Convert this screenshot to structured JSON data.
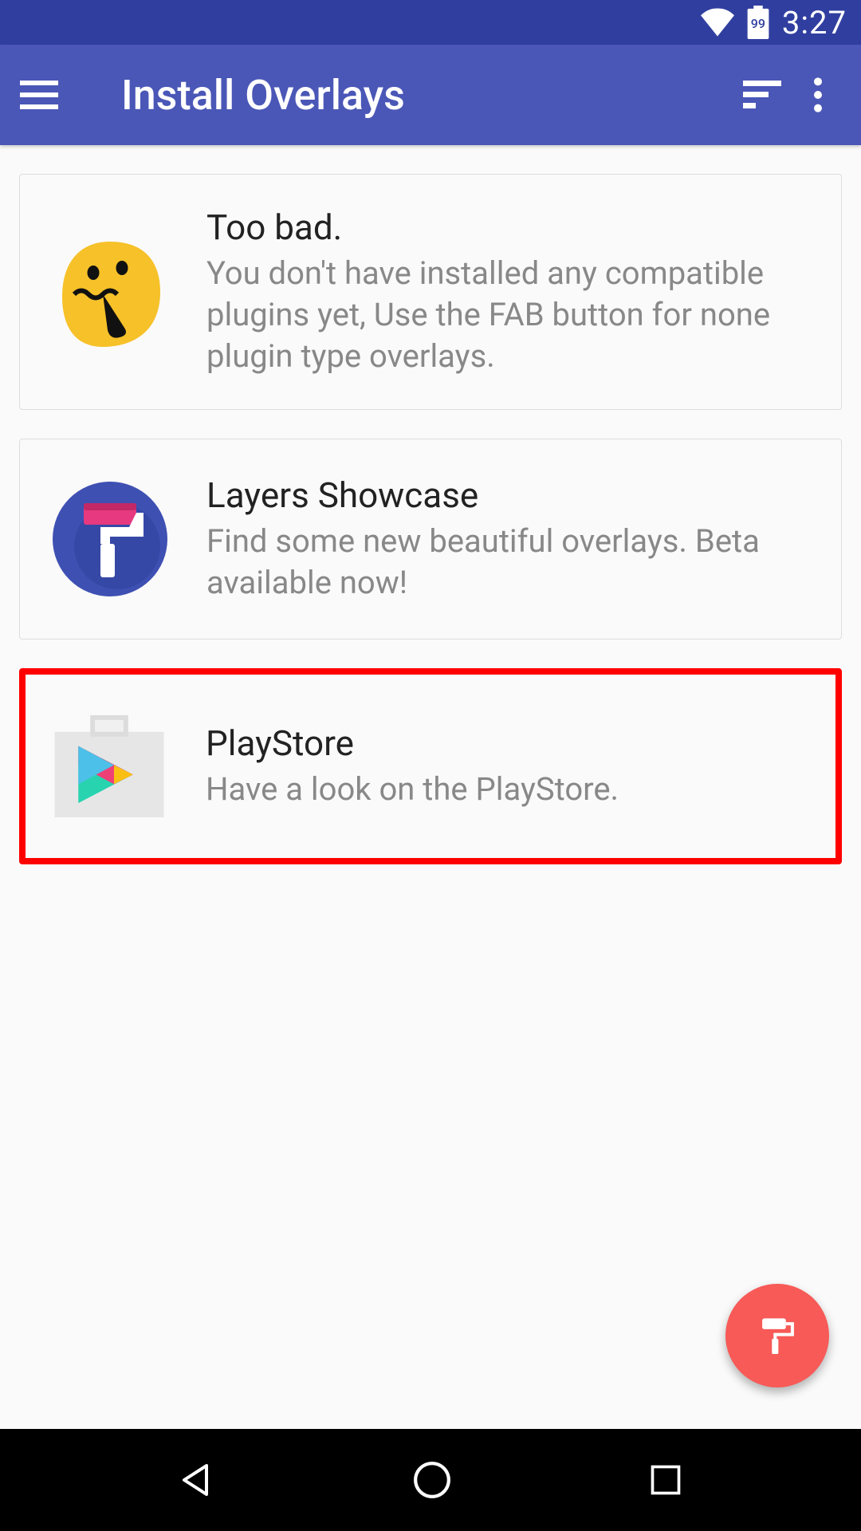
{
  "status": {
    "battery": "99",
    "time": "3:27"
  },
  "appbar": {
    "title": "Install Overlays"
  },
  "cards": [
    {
      "title": "Too bad.",
      "subtitle": "You don't have installed any compatible plugins yet, Use the FAB button for none plugin type overlays.",
      "icon": "sad-emoji"
    },
    {
      "title": "Layers Showcase",
      "subtitle": "Find some new beautiful overlays. Beta available now!",
      "icon": "layers-roller"
    },
    {
      "title": "PlayStore",
      "subtitle": "Have a look on the PlayStore.",
      "icon": "playstore",
      "highlighted": true
    }
  ]
}
